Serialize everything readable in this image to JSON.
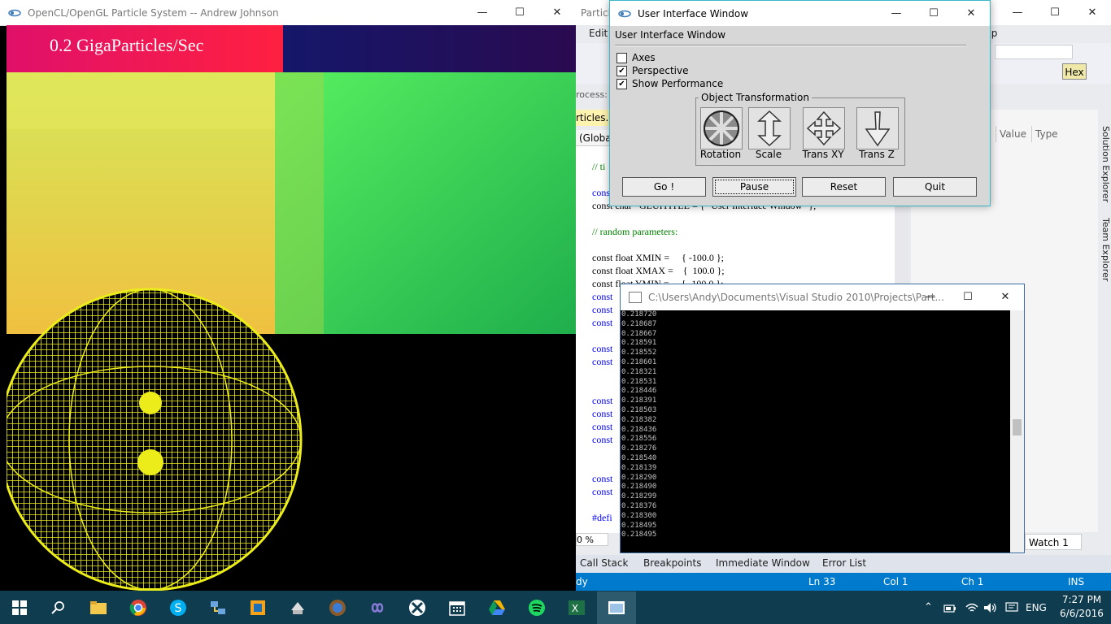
{
  "particle_window": {
    "title": "OpenCL/OpenGL Particle System -- Andrew Johnson",
    "perf_text": "0.2 GigaParticles/Sec"
  },
  "vs": {
    "title_fragment": "Particle",
    "menu_edit": "Edit",
    "menu_help": "elp",
    "process_label": "rocess:",
    "hex_label": "Hex",
    "file_tab": "rticles.cp",
    "scope": "(Globa",
    "code_lines": [
      {
        "text": "// ti",
        "cls": "cm"
      },
      {
        "text": "const",
        "cls": "kw"
      },
      {
        "text": "const char *GLUITITLE = { \"User Interface Window\" };",
        "cls": ""
      },
      {
        "text": "// random parameters:",
        "cls": "cm"
      },
      {
        "text": "const float XMIN =     { -100.0 };",
        "cls": ""
      },
      {
        "text": "const float XMAX =    {  100.0 };",
        "cls": ""
      },
      {
        "text": "const float YMIN =     { -100.0 };",
        "cls": ""
      },
      {
        "text": "const",
        "cls": "kw"
      },
      {
        "text": "const",
        "cls": "kw"
      },
      {
        "text": "const",
        "cls": "kw"
      },
      {
        "text": "const",
        "cls": "kw"
      },
      {
        "text": "const",
        "cls": "kw"
      },
      {
        "text": "const",
        "cls": "kw"
      },
      {
        "text": "const",
        "cls": "kw"
      },
      {
        "text": "const",
        "cls": "kw"
      },
      {
        "text": "const",
        "cls": "kw"
      },
      {
        "text": "const",
        "cls": "kw"
      },
      {
        "text": "const",
        "cls": "kw"
      },
      {
        "text": "#defi",
        "cls": "kw"
      }
    ],
    "zoom": "0 %",
    "watch_headers": [
      "Value",
      "Type"
    ],
    "side_tabs": [
      "Solution Explorer",
      "Team Explorer"
    ],
    "bottom_tabs": [
      "Call Stack",
      "Breakpoints",
      "Immediate Window",
      "Error List"
    ],
    "watch_tab": "Watch 1",
    "status": {
      "left": "dy",
      "ln": "Ln 33",
      "col": "Col 1",
      "ch": "Ch 1",
      "mode": "INS"
    }
  },
  "ui_window": {
    "title": "User Interface Window",
    "header": "User Interface Window",
    "checkboxes": [
      {
        "label": "Axes",
        "checked": false
      },
      {
        "label": "Perspective",
        "checked": true
      },
      {
        "label": "Show Performance",
        "checked": true
      }
    ],
    "group_label": "Object Transformation",
    "tools": [
      "Rotation",
      "Scale",
      "Trans XY",
      "Trans Z"
    ],
    "buttons": [
      "Go !",
      "Pause",
      "Reset",
      "Quit"
    ]
  },
  "console": {
    "title": "C:\\Users\\Andy\\Documents\\Visual Studio 2010\\Projects\\Part...",
    "lines": [
      "0.218720",
      "0.218687",
      "0.218667",
      "0.218591",
      "0.218552",
      "0.218601",
      "0.218321",
      "0.218531",
      "0.218446",
      "0.218391",
      "0.218503",
      "0.218382",
      "0.218436",
      "0.218556",
      "0.218276",
      "0.218540",
      "0.218139",
      "0.218290",
      "0.218490",
      "0.218299",
      "0.218376",
      "0.218300",
      "0.218495",
      "0.218495"
    ]
  },
  "taskbar": {
    "lang": "ENG",
    "time": "7:27 PM",
    "date": "6/6/2016"
  }
}
